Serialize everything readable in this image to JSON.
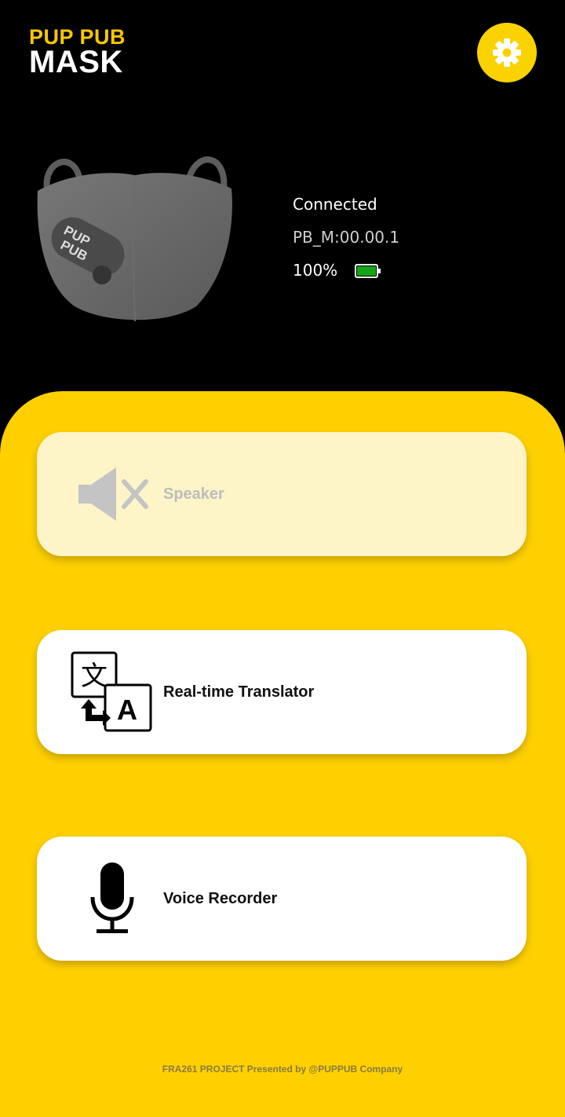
{
  "header": {
    "brand_top": "PUP PUB",
    "brand_bottom": "MASK",
    "settings_icon": "gear-icon"
  },
  "device": {
    "image": "face-mask",
    "status": "Connected",
    "id": "PB_M:00.00.1",
    "battery": "100%",
    "battery_level": 1.0
  },
  "actions": [
    {
      "label": "Speaker",
      "icon": "speaker-muted-icon",
      "enabled": false
    },
    {
      "label": "Real-time Translator",
      "icon": "translate-icon",
      "enabled": true
    },
    {
      "label": "Voice Recorder",
      "icon": "microphone-icon",
      "enabled": true
    }
  ],
  "footer": {
    "text": "FRA261 PROJECT Presented by @PUPPUB Company"
  },
  "colors": {
    "accent": "#ffd000",
    "background": "#000000",
    "card": "#ffffff",
    "battery": "#16a316"
  }
}
